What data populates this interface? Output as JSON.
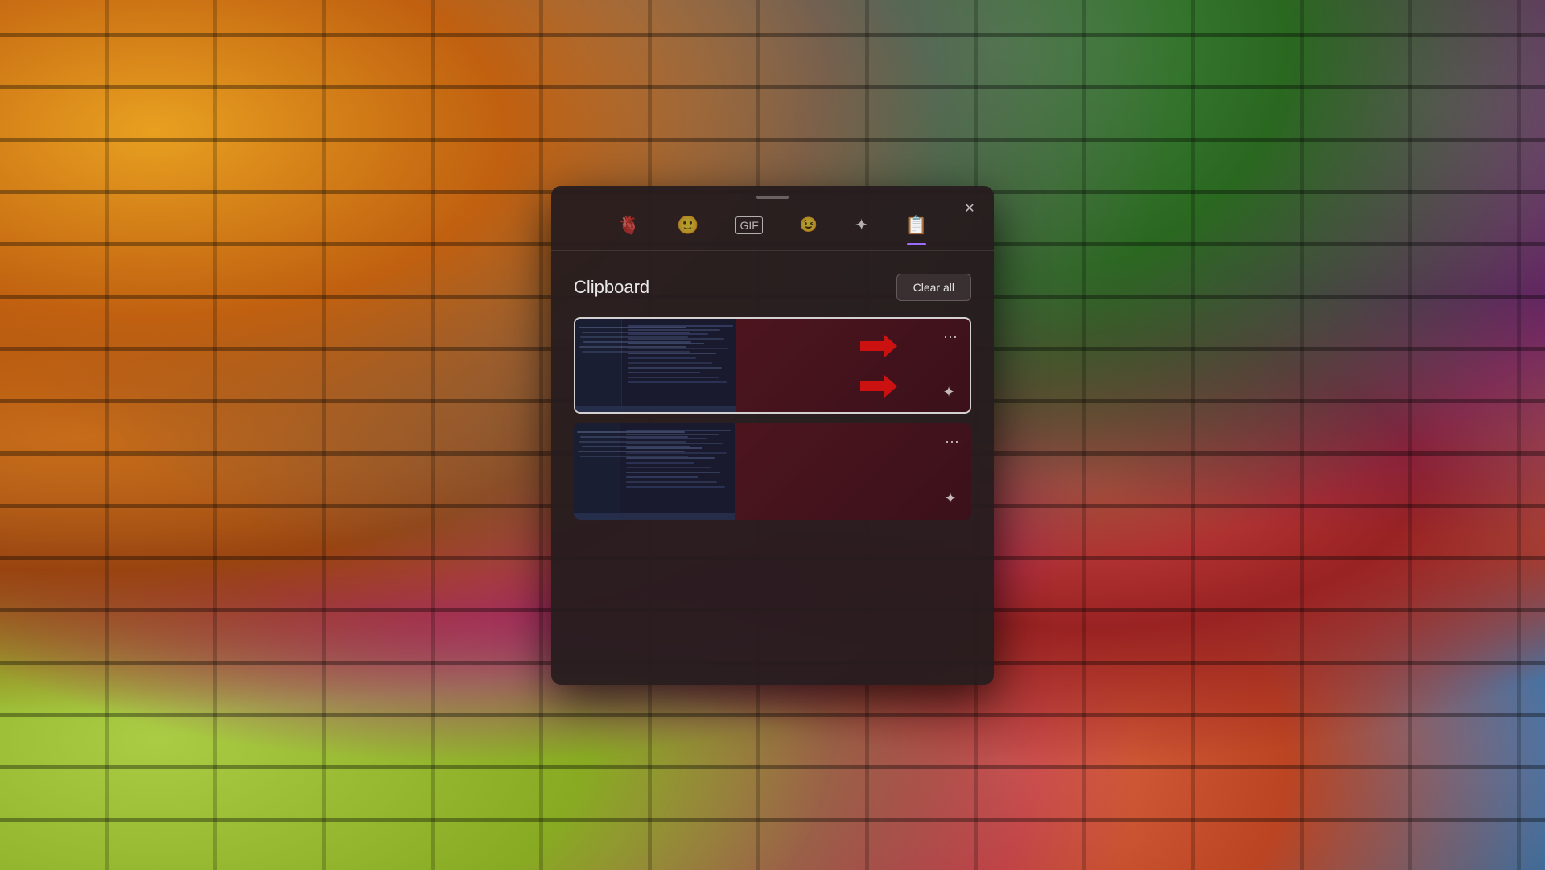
{
  "background": {
    "description": "colorful brick wall"
  },
  "panel": {
    "drag_handle": "drag-handle",
    "close_button_label": "×",
    "tabs": [
      {
        "id": "kaomoji",
        "icon": "🫀",
        "label": "Kaomoji",
        "active": false
      },
      {
        "id": "emoji",
        "icon": "🙂",
        "label": "Emoji",
        "active": false
      },
      {
        "id": "gif",
        "icon": "GIF",
        "label": "GIF",
        "active": false
      },
      {
        "id": "kaomoji2",
        "icon": ";-)",
        "label": "Kaomoji",
        "active": false
      },
      {
        "id": "special",
        "icon": "✦+",
        "label": "Special Characters",
        "active": false
      },
      {
        "id": "clipboard",
        "icon": "📋",
        "label": "Clipboard",
        "active": true
      }
    ],
    "content": {
      "title": "Clipboard",
      "clear_all_label": "Clear all",
      "items": [
        {
          "id": "item1",
          "selected": true,
          "has_arrows": true,
          "has_pin": true,
          "has_more": true
        },
        {
          "id": "item2",
          "selected": false,
          "has_arrows": false,
          "has_pin": true,
          "has_more": true
        }
      ]
    }
  }
}
